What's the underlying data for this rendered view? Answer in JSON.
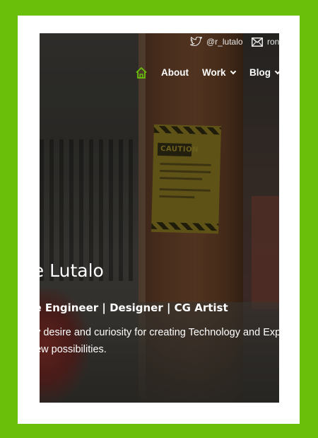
{
  "colors": {
    "page_background": "#6abf0b",
    "card_background": "#ffffff",
    "nav_active": "#6abf0b",
    "text": "#ffffff"
  },
  "topbar": {
    "twitter": {
      "icon": "twitter-icon",
      "label": "@r_lutalo"
    },
    "email": {
      "icon": "mail-icon",
      "label": "ron"
    }
  },
  "nav": {
    "home_icon": "home-icon",
    "items": [
      {
        "label": "About",
        "has_dropdown": false
      },
      {
        "label": "Work",
        "has_dropdown": true
      },
      {
        "label": "Blog",
        "has_dropdown": true
      }
    ]
  },
  "hero": {
    "name": "nie Lutalo",
    "tagline": "are Engineer | Designer | CG Artist",
    "description_line1": "by desire and curiosity for creating Technology and Exp",
    "description_line2": "new possibilities.",
    "sign_text": "CAUTION"
  }
}
